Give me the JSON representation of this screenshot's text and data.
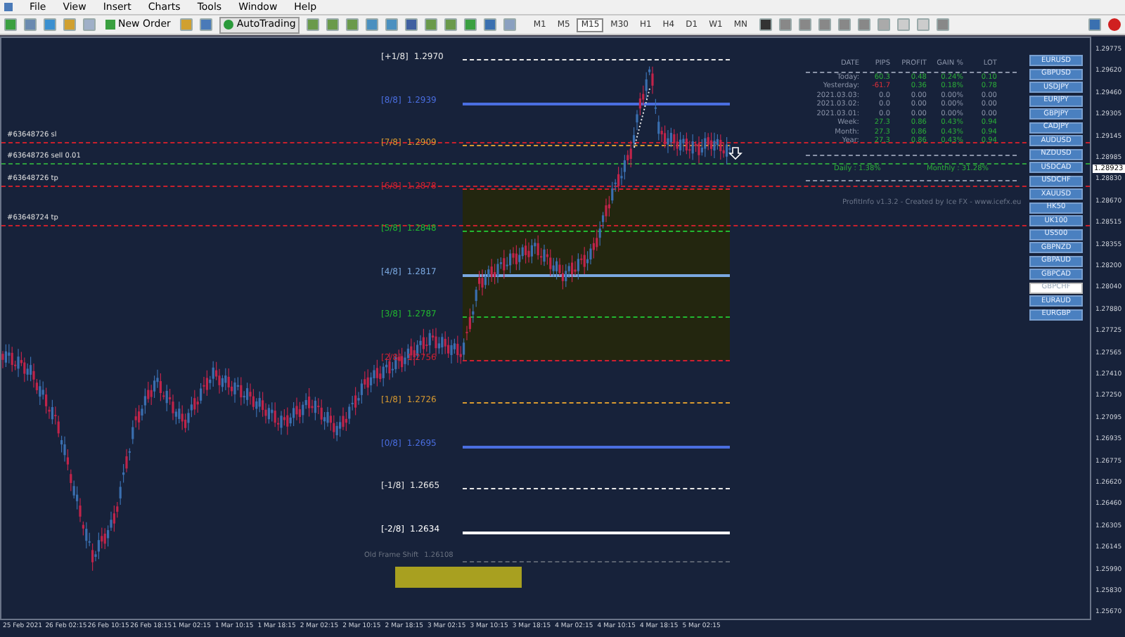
{
  "menu": [
    "File",
    "View",
    "Insert",
    "Charts",
    "Tools",
    "Window",
    "Help"
  ],
  "toolbar": {
    "new_order": "New Order",
    "auto_trading": "AutoTrading",
    "timeframes": [
      {
        "label": "M1",
        "selected": false
      },
      {
        "label": "M5",
        "selected": false
      },
      {
        "label": "M15",
        "selected": true
      },
      {
        "label": "M30",
        "selected": false
      },
      {
        "label": "H1",
        "selected": false
      },
      {
        "label": "H4",
        "selected": false
      },
      {
        "label": "D1",
        "selected": false
      },
      {
        "label": "W1",
        "selected": false
      },
      {
        "label": "MN",
        "selected": false
      }
    ]
  },
  "order_lines": [
    {
      "label": "#63648726 sl",
      "color": "#c8202c"
    },
    {
      "label": "#63648726 sell 0.01",
      "color": "#2e9e3e"
    },
    {
      "label": "#63648726 tp",
      "color": "#c8202c"
    },
    {
      "label": "#63648724 tp",
      "color": "#c8202c"
    }
  ],
  "levels": [
    {
      "label": "[+1/8]",
      "price": "1.2970",
      "color": "#e8e8e8",
      "kind": "dashed"
    },
    {
      "label": "[8/8]",
      "price": "1.2939",
      "color": "#4a6ee0",
      "kind": "solid"
    },
    {
      "label": "[7/8]",
      "price": "1.2909",
      "color": "#d89a30",
      "kind": "dashed"
    },
    {
      "label": "[6/8]",
      "price": "1.2878",
      "color": "#d02030",
      "kind": "dashed"
    },
    {
      "label": "[5/8]",
      "price": "1.2848",
      "color": "#22b830",
      "kind": "dashed"
    },
    {
      "label": "[4/8]",
      "price": "1.2817",
      "color": "#7aa8e0",
      "kind": "solid"
    },
    {
      "label": "[3/8]",
      "price": "1.2787",
      "color": "#22b830",
      "kind": "dashed"
    },
    {
      "label": "[2/8]",
      "price": "1.2756",
      "color": "#d02030",
      "kind": "dashed"
    },
    {
      "label": "[1/8]",
      "price": "1.2726",
      "color": "#d89a30",
      "kind": "dashed"
    },
    {
      "label": "[0/8]",
      "price": "1.2695",
      "color": "#4a6ee0",
      "kind": "solid"
    },
    {
      "label": "[-1/8]",
      "price": "1.2665",
      "color": "#e8e8e8",
      "kind": "dashed"
    },
    {
      "label": "[-2/8]",
      "price": "1.2634",
      "color": "#ffffff",
      "kind": "solid"
    }
  ],
  "old_frame": {
    "label": "Old Frame Shift",
    "price": "1.26108"
  },
  "stats": {
    "columns": [
      "DATE",
      "PIPS",
      "PROFIT",
      "GAIN %",
      "LOT"
    ],
    "rows": [
      {
        "cells": [
          {
            "text": "Today:",
            "color": "#8a93a8"
          },
          {
            "text": "60.3",
            "color": "#2cae38"
          },
          {
            "text": "0.48",
            "color": "#2cae38"
          },
          {
            "text": "0.24%",
            "color": "#2cae38"
          },
          {
            "text": "0.10",
            "color": "#2cae38"
          }
        ]
      },
      {
        "cells": [
          {
            "text": "Yesterday:",
            "color": "#8a93a8"
          },
          {
            "text": "-61.7",
            "color": "#e0303a"
          },
          {
            "text": "0.36",
            "color": "#2cae38"
          },
          {
            "text": "0.18%",
            "color": "#2cae38"
          },
          {
            "text": "0.78",
            "color": "#2cae38"
          }
        ]
      },
      {
        "cells": [
          {
            "text": "2021.03.03:",
            "color": "#8a93a8"
          },
          {
            "text": "0.0",
            "color": "#8a93a8"
          },
          {
            "text": "0.00",
            "color": "#8a93a8"
          },
          {
            "text": "0.00%",
            "color": "#8a93a8"
          },
          {
            "text": "0.00",
            "color": "#8a93a8"
          }
        ]
      },
      {
        "cells": [
          {
            "text": "2021.03.02:",
            "color": "#8a93a8"
          },
          {
            "text": "0.0",
            "color": "#8a93a8"
          },
          {
            "text": "0.00",
            "color": "#8a93a8"
          },
          {
            "text": "0.00%",
            "color": "#8a93a8"
          },
          {
            "text": "0.00",
            "color": "#8a93a8"
          }
        ]
      },
      {
        "cells": [
          {
            "text": "2021.03.01:",
            "color": "#8a93a8"
          },
          {
            "text": "0.0",
            "color": "#8a93a8"
          },
          {
            "text": "0.00",
            "color": "#8a93a8"
          },
          {
            "text": "0.00%",
            "color": "#8a93a8"
          },
          {
            "text": "0.00",
            "color": "#8a93a8"
          }
        ]
      },
      {
        "cells": [
          {
            "text": "Week:",
            "color": "#8a93a8"
          },
          {
            "text": "27.3",
            "color": "#2cae38"
          },
          {
            "text": "0.86",
            "color": "#2cae38"
          },
          {
            "text": "0.43%",
            "color": "#2cae38"
          },
          {
            "text": "0.94",
            "color": "#2cae38"
          }
        ]
      },
      {
        "cells": [
          {
            "text": "Month:",
            "color": "#8a93a8"
          },
          {
            "text": "27.3",
            "color": "#2cae38"
          },
          {
            "text": "0.86",
            "color": "#2cae38"
          },
          {
            "text": "0.43%",
            "color": "#2cae38"
          },
          {
            "text": "0.94",
            "color": "#2cae38"
          }
        ]
      },
      {
        "cells": [
          {
            "text": "Year:",
            "color": "#8a93a8"
          },
          {
            "text": "27.3",
            "color": "#2cae38"
          },
          {
            "text": "0.86",
            "color": "#2cae38"
          },
          {
            "text": "0.43%",
            "color": "#2cae38"
          },
          {
            "text": "0.94",
            "color": "#2cae38"
          }
        ]
      }
    ],
    "daily": "Daily : 1.38%",
    "monthly": "Monthly : 31.28%",
    "footer": "ProfitInfo v1.3.2 - Created by Ice FX - www.icefx.eu"
  },
  "symbols": [
    {
      "label": "EURUSD",
      "selected": false
    },
    {
      "label": "GBPUSD",
      "selected": false
    },
    {
      "label": "USDJPY",
      "selected": false
    },
    {
      "label": "EURJPY",
      "selected": false
    },
    {
      "label": "GBPJPY",
      "selected": false
    },
    {
      "label": "CADJPY",
      "selected": false
    },
    {
      "label": "AUDUSD",
      "selected": false
    },
    {
      "label": "NZDUSD",
      "selected": false
    },
    {
      "label": "USDCAD",
      "selected": false
    },
    {
      "label": "USDCHF",
      "selected": false
    },
    {
      "label": "XAUUSD",
      "selected": false
    },
    {
      "label": "HK50",
      "selected": false
    },
    {
      "label": "UK100",
      "selected": false
    },
    {
      "label": "US500",
      "selected": false
    },
    {
      "label": "GBPNZD",
      "selected": false
    },
    {
      "label": "GBPAUD",
      "selected": false
    },
    {
      "label": "GBPCAD",
      "selected": false
    },
    {
      "label": "GBPCHF",
      "selected": true
    },
    {
      "label": "EURAUD",
      "selected": false
    },
    {
      "label": "EURGBP",
      "selected": false
    }
  ],
  "price_axis": [
    "1.29775",
    "1.29620",
    "1.29460",
    "1.29305",
    "1.29145",
    "1.28985",
    "1.28830",
    "1.28670",
    "1.28515",
    "1.28355",
    "1.28200",
    "1.28040",
    "1.27880",
    "1.27725",
    "1.27565",
    "1.27410",
    "1.27250",
    "1.27095",
    "1.26935",
    "1.26775",
    "1.26620",
    "1.26460",
    "1.26305",
    "1.26145",
    "1.25990",
    "1.25830",
    "1.25670"
  ],
  "current_price": "1.28923",
  "time_axis": [
    "25 Feb 2021",
    "26 Feb 02:15",
    "26 Feb 10:15",
    "26 Feb 18:15",
    "1 Mar 02:15",
    "1 Mar 10:15",
    "1 Mar 18:15",
    "2 Mar 02:15",
    "2 Mar 10:15",
    "2 Mar 18:15",
    "3 Mar 02:15",
    "3 Mar 10:15",
    "3 Mar 18:15",
    "4 Mar 02:15",
    "4 Mar 10:15",
    "4 Mar 18:15",
    "5 Mar 02:15"
  ]
}
